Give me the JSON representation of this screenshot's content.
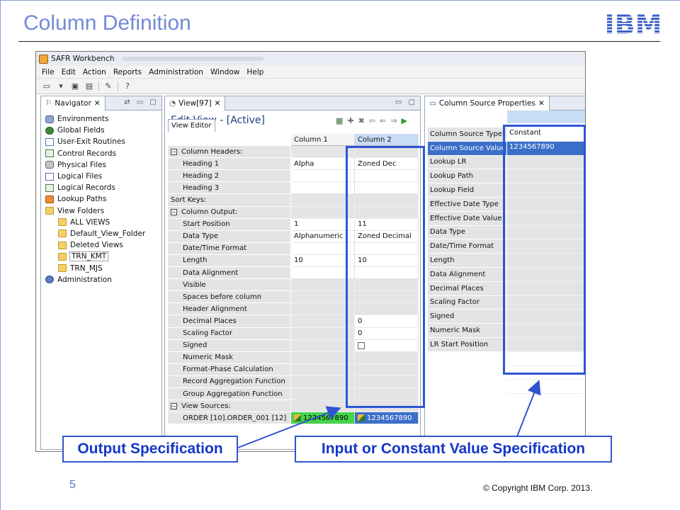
{
  "slide": {
    "title": "Column Definition",
    "logo": "IBM",
    "page_number": "5",
    "copyright": "© Copyright  IBM Corp. 2013."
  },
  "app": {
    "window_title": "SAFR Workbench",
    "menu": [
      "File",
      "Edit",
      "Action",
      "Reports",
      "Administration",
      "Window",
      "Help"
    ]
  },
  "navigator": {
    "tab_label": "Navigator",
    "items": [
      {
        "label": "Environments",
        "icon": "gear-icon",
        "level": 0
      },
      {
        "label": "Global Fields",
        "icon": "globe-icon",
        "level": 0
      },
      {
        "label": "User-Exit Routines",
        "icon": "document-icon",
        "level": 0
      },
      {
        "label": "Control Records",
        "icon": "grid-icon",
        "level": 0
      },
      {
        "label": "Physical Files",
        "icon": "database-icon",
        "level": 0
      },
      {
        "label": "Logical Files",
        "icon": "document-icon",
        "level": 0
      },
      {
        "label": "Logical Records",
        "icon": "grid-icon",
        "level": 0
      },
      {
        "label": "Lookup Paths",
        "icon": "lookup-icon",
        "level": 0
      },
      {
        "label": "View Folders",
        "icon": "folder-icon",
        "level": 0
      },
      {
        "label": "ALL VIEWS",
        "icon": "folder-icon",
        "level": 1
      },
      {
        "label": "Default_View_Folder",
        "icon": "folder-icon",
        "level": 1
      },
      {
        "label": "Deleted Views",
        "icon": "folder-icon",
        "level": 1
      },
      {
        "label": "TRN_KMT",
        "icon": "folder-icon",
        "level": 1,
        "selected": true
      },
      {
        "label": "TRN_MJS",
        "icon": "folder-icon",
        "level": 1
      },
      {
        "label": "Administration",
        "icon": "admin-icon",
        "level": 0
      }
    ]
  },
  "view_editor": {
    "tab_label": "View[97]",
    "title": "Edit View - [Active]",
    "subtab": "View Editor",
    "columns": [
      "Column 1",
      "Column 2"
    ],
    "rows": [
      {
        "label": "Column Headers:",
        "kind": "section",
        "c1": "",
        "c2": ""
      },
      {
        "label": "Heading 1",
        "kind": "field",
        "c1": "Alpha",
        "c2": "Zoned Dec"
      },
      {
        "label": "Heading 2",
        "kind": "field",
        "c1": "",
        "c2": ""
      },
      {
        "label": "Heading 3",
        "kind": "field",
        "c1": "",
        "c2": ""
      },
      {
        "label": "Sort Keys:",
        "kind": "plain",
        "c1": "",
        "c2": ""
      },
      {
        "label": "Column Output:",
        "kind": "section",
        "c1": "",
        "c2": ""
      },
      {
        "label": "Start Position",
        "kind": "field",
        "c1": "1",
        "c2": "11"
      },
      {
        "label": "Data Type",
        "kind": "field",
        "c1": "Alphanumeric",
        "c2": "Zoned Decimal"
      },
      {
        "label": "Date/Time Format",
        "kind": "field",
        "c1": "",
        "c2": ""
      },
      {
        "label": "Length",
        "kind": "field",
        "c1": "10",
        "c2": "10"
      },
      {
        "label": "Data Alignment",
        "kind": "field",
        "c1": "",
        "c2": ""
      },
      {
        "label": "Visible",
        "kind": "grey",
        "c1": "",
        "c2": ""
      },
      {
        "label": "Spaces before column",
        "kind": "grey",
        "c1": "",
        "c2": ""
      },
      {
        "label": "Header Alignment",
        "kind": "grey",
        "c1": "",
        "c2": ""
      },
      {
        "label": "Decimal Places",
        "kind": "grey1",
        "c1": "",
        "c2": "0"
      },
      {
        "label": "Scaling Factor",
        "kind": "grey1",
        "c1": "",
        "c2": "0"
      },
      {
        "label": "Signed",
        "kind": "checkbox",
        "c1": "",
        "c2": ""
      },
      {
        "label": "Numeric Mask",
        "kind": "grey",
        "c1": "",
        "c2": ""
      },
      {
        "label": "Format-Phase Calculation",
        "kind": "grey",
        "c1": "",
        "c2": ""
      },
      {
        "label": "Record Aggregation Function",
        "kind": "grey",
        "c1": "",
        "c2": ""
      },
      {
        "label": "Group Aggregation Function",
        "kind": "grey",
        "c1": "",
        "c2": ""
      },
      {
        "label": "View Sources:",
        "kind": "section",
        "c1": "",
        "c2": ""
      },
      {
        "label": "ORDER [10].ORDER_001 [12]",
        "kind": "source",
        "c1": "1234567890",
        "c2": "1234567890"
      }
    ]
  },
  "source_props": {
    "tab_label": "Column Source Properties",
    "rows": [
      {
        "label": "Column Source Type",
        "value": "Constant",
        "state": "white"
      },
      {
        "label": "Column Source Value",
        "value": "1234567890",
        "state": "selected"
      },
      {
        "label": "Lookup LR",
        "value": ""
      },
      {
        "label": "Lookup Path",
        "value": ""
      },
      {
        "label": "Lookup Field",
        "value": ""
      },
      {
        "label": "Effective Date Type",
        "value": ""
      },
      {
        "label": "Effective Date Value",
        "value": ""
      },
      {
        "label": "Data Type",
        "value": ""
      },
      {
        "label": "Date/Time Format",
        "value": ""
      },
      {
        "label": "Length",
        "value": ""
      },
      {
        "label": "Data Alignment",
        "value": ""
      },
      {
        "label": "Decimal Places",
        "value": ""
      },
      {
        "label": "Scaling Factor",
        "value": ""
      },
      {
        "label": "Signed",
        "value": ""
      },
      {
        "label": "Numeric Mask",
        "value": ""
      },
      {
        "label": "LR Start Position",
        "value": ""
      }
    ]
  },
  "callouts": {
    "output": "Output Specification",
    "input": "Input or Constant Value Specification"
  },
  "colors": {
    "accent": "#2f55d4",
    "title": "#7589d8",
    "selection": "#3b6fc9",
    "source_green": "#45d34a"
  }
}
